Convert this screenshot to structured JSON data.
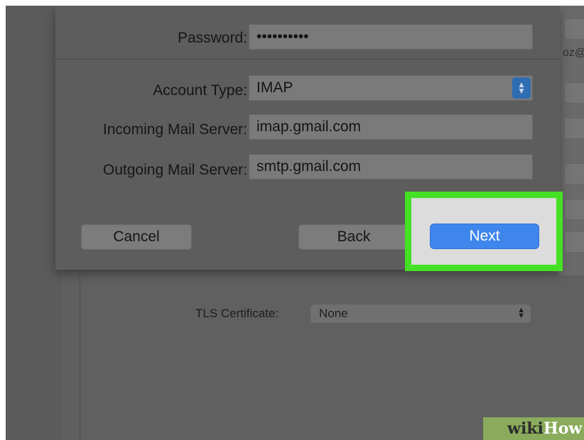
{
  "form": {
    "password_label": "Password:",
    "password_value": "••••••••••",
    "account_type_label": "Account Type:",
    "account_type_value": "IMAP",
    "incoming_label": "Incoming Mail Server:",
    "incoming_value": "imap.gmail.com",
    "outgoing_label": "Outgoing Mail Server:",
    "outgoing_value": "smtp.gmail.com"
  },
  "buttons": {
    "cancel": "Cancel",
    "back": "Back",
    "next": "Next"
  },
  "background": {
    "email_fragment": "oz@",
    "tls_label": "TLS Certificate:",
    "tls_value": "None"
  },
  "watermark": {
    "wiki": "wiki",
    "how": "How"
  },
  "colors": {
    "highlight_border": "#45e024",
    "next_button": "#3f86ec",
    "watermark_bg": "#8aab5c"
  }
}
